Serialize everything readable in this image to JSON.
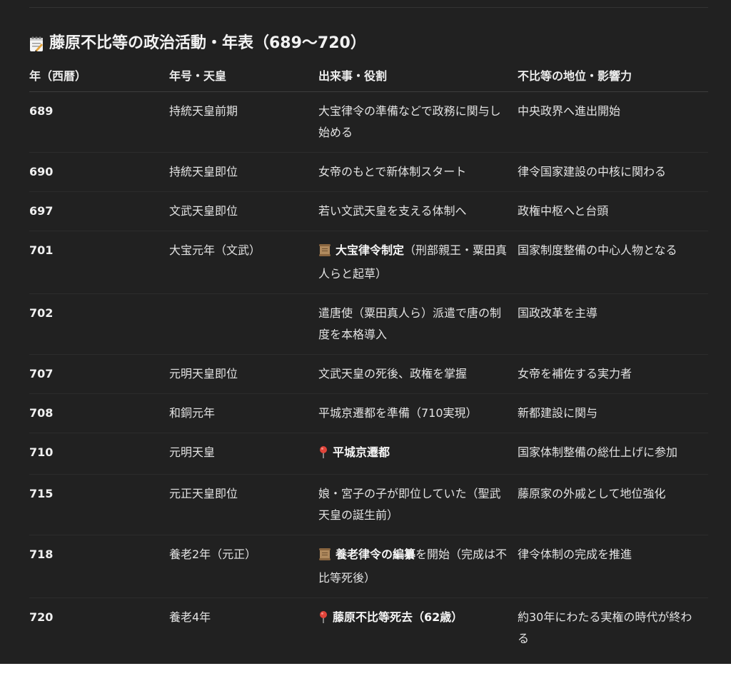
{
  "title": "藤原不比等の政治活動・年表（689〜720）",
  "headers": [
    "年（西暦）",
    "年号・天皇",
    "出来事・役割",
    "不比等の地位・影響力"
  ],
  "rows": [
    {
      "year": "689",
      "era": "持統天皇前期",
      "event": "大宝律令の準備などで政務に関与し始める",
      "influence": "中央政界へ進出開始"
    },
    {
      "year": "690",
      "era": "持統天皇即位",
      "event": "女帝のもとで新体制スタート",
      "influence": "律令国家建設の中核に関わる"
    },
    {
      "year": "697",
      "era": "文武天皇即位",
      "event": "若い文武天皇を支える体制へ",
      "influence": "政権中枢へと台頭"
    },
    {
      "year": "701",
      "era": "大宝元年（文武）",
      "event_icon": "scroll-icon",
      "event_strong": "大宝律令制定",
      "event": "（刑部親王・粟田真人らと起草）",
      "influence": "国家制度整備の中心人物となる"
    },
    {
      "year": "702",
      "era": "",
      "event": "遣唐使（粟田真人ら）派遣で唐の制度を本格導入",
      "influence": "国政改革を主導"
    },
    {
      "year": "707",
      "era": "元明天皇即位",
      "event": "文武天皇の死後、政権を掌握",
      "influence": "女帝を補佐する実力者"
    },
    {
      "year": "708",
      "era": "和銅元年",
      "event": "平城京遷都を準備（710実現）",
      "influence": "新都建設に関与"
    },
    {
      "year": "710",
      "era": "元明天皇",
      "event_icon": "pin-icon",
      "event_strong": "平城京遷都",
      "event": "",
      "influence": "国家体制整備の総仕上げに参加"
    },
    {
      "year": "715",
      "era": "元正天皇即位",
      "event": "娘・宮子の子が即位していた（聖武天皇の誕生前）",
      "influence": "藤原家の外戚として地位強化"
    },
    {
      "year": "718",
      "era": "養老2年（元正）",
      "event_icon": "scroll-icon",
      "event_strong": "養老律令の編纂",
      "event": "を開始（完成は不比等死後）",
      "influence": "律令体制の完成を推進"
    },
    {
      "year": "720",
      "era": "養老4年",
      "event_icon": "pin-icon",
      "event_strong": "藤原不比等死去（62歳）",
      "event": "",
      "influence": "約30年にわたる実権の時代が終わる"
    }
  ],
  "colors": {
    "background": "#212121",
    "text": "#ececec",
    "scroll": "#b08a5e",
    "pin": "#e0443a"
  }
}
